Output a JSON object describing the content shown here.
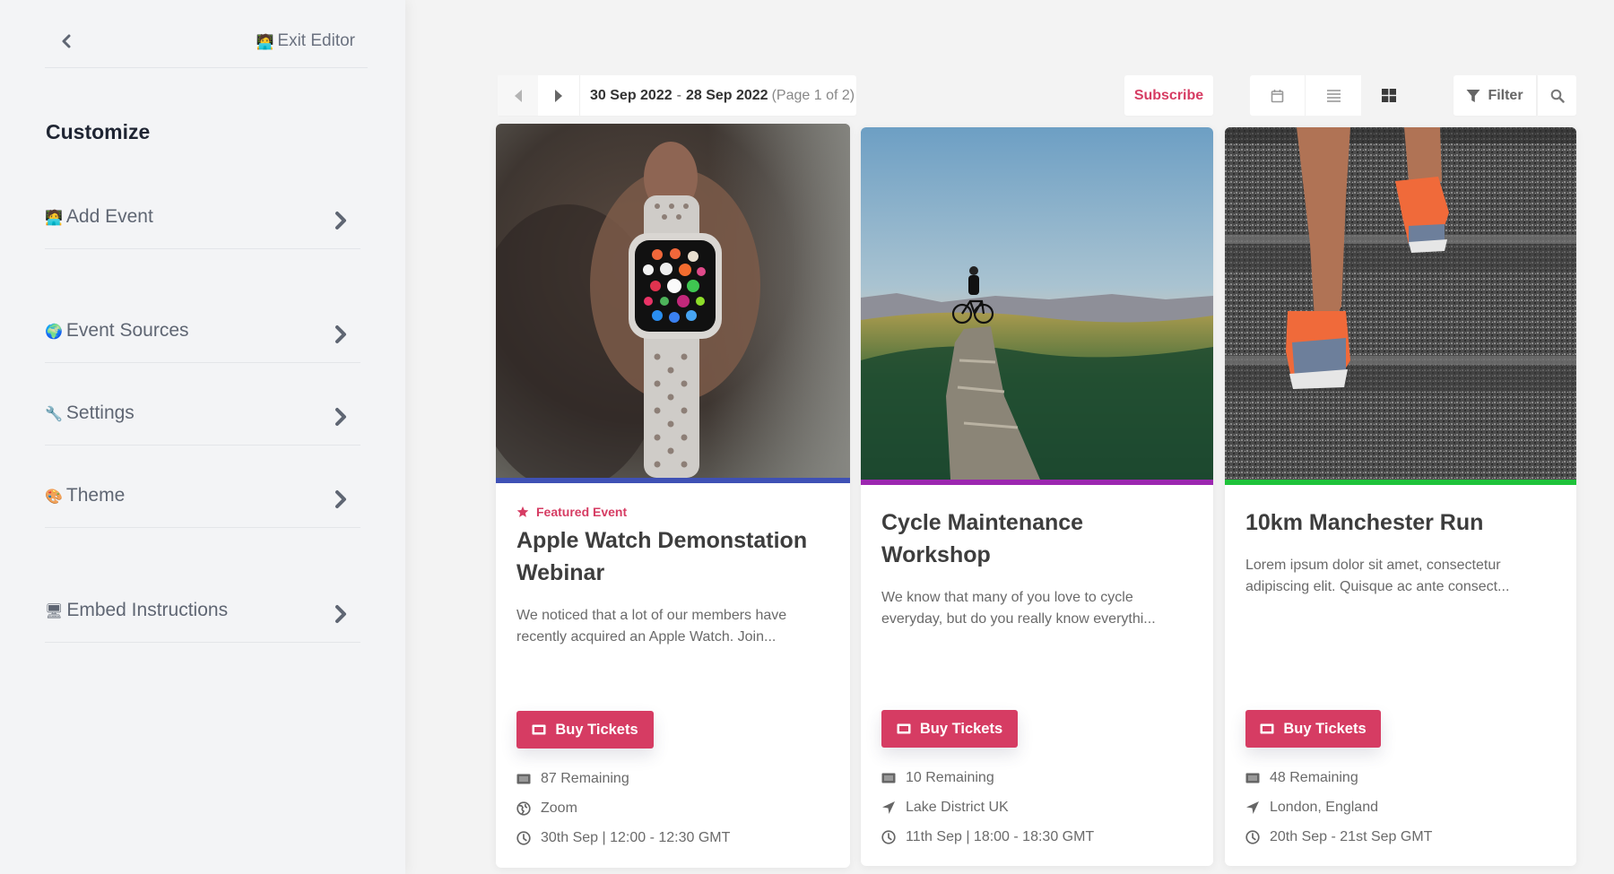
{
  "sidebar": {
    "back_icon": "chevron-left-icon",
    "exit_editor": {
      "emoji": "🧑‍💻",
      "label": "Exit Editor"
    },
    "title": "Customize",
    "items": [
      {
        "emoji": "🧑‍💻",
        "label": "Add Event",
        "icon": "technologist-emoji"
      },
      {
        "emoji": "🌍",
        "label": "Event Sources",
        "icon": "globe-emoji"
      },
      {
        "emoji": "🔧",
        "label": "Settings",
        "icon": "wrench-emoji"
      },
      {
        "emoji": "🎨",
        "label": "Theme",
        "icon": "palette-emoji"
      },
      {
        "emoji": "🖥",
        "label": "Embed Instructions",
        "icon": "desktop-emoji"
      }
    ]
  },
  "toolbar": {
    "date_from": "30 Sep 2022",
    "date_sep": "-",
    "date_to": "28 Sep 2022",
    "page_info": "(Page 1 of 2)",
    "subscribe_label": "Subscribe",
    "views": [
      {
        "name": "calendar-view",
        "icon": "calendar-icon",
        "active": false
      },
      {
        "name": "list-view",
        "icon": "list-icon",
        "active": false
      },
      {
        "name": "grid-view",
        "icon": "grid-icon",
        "active": true
      }
    ],
    "filter_label": "Filter"
  },
  "colors": {
    "accent": "#d63c63",
    "card_bars": [
      "#3f51b5",
      "#9c27b0",
      "#1fc23a"
    ]
  },
  "events": [
    {
      "featured_label": "Featured Event",
      "title": "Apple Watch Demonstation Webinar",
      "description": "We noticed that a lot of our members have recently acquired an Apple Watch. Join...",
      "buy_label": "Buy Tickets",
      "remaining": "87 Remaining",
      "location": "Zoom",
      "location_icon": "globe-icon",
      "datetime": "30th Sep | 12:00 - 12:30 GMT"
    },
    {
      "title": "Cycle Maintenance Workshop",
      "description": "We know that many of you love to cycle everyday, but do you really know everythi...",
      "buy_label": "Buy Tickets",
      "remaining": "10 Remaining",
      "location": "Lake District UK",
      "location_icon": "location-arrow-icon",
      "datetime": "11th Sep | 18:00 - 18:30 GMT"
    },
    {
      "title": "10km Manchester Run",
      "description": "Lorem ipsum dolor sit amet, consectetur adipiscing elit. Quisque ac ante consect...",
      "buy_label": "Buy Tickets",
      "remaining": "48 Remaining",
      "location": "London, England",
      "location_icon": "location-arrow-icon",
      "datetime": "20th Sep - 21st Sep GMT"
    }
  ]
}
